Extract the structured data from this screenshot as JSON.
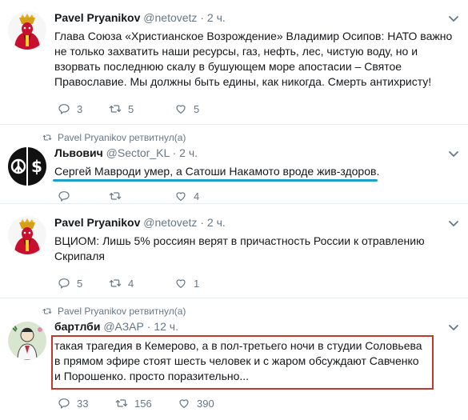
{
  "tweets": [
    {
      "author_name": "Pavel Pryanikov",
      "handle": "@netovetz",
      "separator": "·",
      "time": "2 ч.",
      "text": "Глава Союза «Христианское Возрождение» Владимир Осипов: НАТО важно не только захватить наши ресурсы, газ, нефть, лес, чистую воду, но и взорвать последнюю скалу в бушующем море апостасии – Святое Православие. Мы должны быть едины, как никогда. Смерть антихристу!",
      "replies": "3",
      "retweets": "5",
      "likes": "5"
    },
    {
      "retweeted_by": "Pavel Pryanikov ретвитнул(а)",
      "author_name": "Львович",
      "handle": "@Sector_KL",
      "separator": "·",
      "time": "2 ч.",
      "text": "Сергей Мавроди умер, а Сатоши Накамото вроде жив-здоров.",
      "replies": "",
      "retweets": "",
      "likes": "4"
    },
    {
      "author_name": "Pavel Pryanikov",
      "handle": "@netovetz",
      "separator": "·",
      "time": "2 ч.",
      "text": "ВЦИОМ: Лишь 5% россиян верят в причастность России к отравлению Скрипаля",
      "replies": "5",
      "retweets": "4",
      "likes": "1"
    },
    {
      "retweeted_by": "Pavel Pryanikov ретвитнул(а)",
      "author_name": "бартлби",
      "handle": "@АЗАР",
      "separator": "·",
      "time": "12 ч.",
      "text": "такая трагедия в Кемерово, а в пол-третьего ночи в студии Соловьева в прямом эфире стоят шесть человек и с жаром обсуждают Савченко и Порошенко. просто поразительно...",
      "replies": "33",
      "retweets": "156",
      "likes": "390"
    }
  ],
  "colors": {
    "icon_gray": "#657786",
    "highlight_underline": "#1da1c8",
    "highlight_box": "#c0392b",
    "avatar_red": "#c8102e"
  },
  "icons": [
    "reply-icon",
    "retweet-icon",
    "like-icon",
    "caret-down-icon",
    "retweeted-icon"
  ]
}
